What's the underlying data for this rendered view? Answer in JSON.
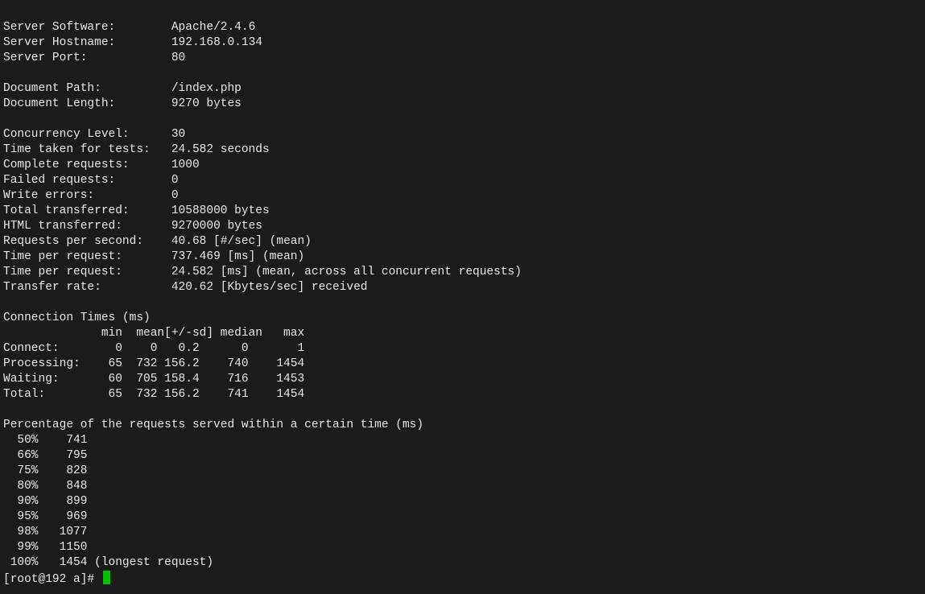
{
  "section1": {
    "server_software_label": "Server Software:",
    "server_software": "Apache/2.4.6",
    "server_hostname_label": "Server Hostname:",
    "server_hostname": "192.168.0.134",
    "server_port_label": "Server Port:",
    "server_port": "80"
  },
  "section2": {
    "document_path_label": "Document Path:",
    "document_path": "/index.php",
    "document_length_label": "Document Length:",
    "document_length": "9270 bytes"
  },
  "section3": {
    "concurrency_label": "Concurrency Level:",
    "concurrency": "30",
    "time_taken_label": "Time taken for tests:",
    "time_taken": "24.582 seconds",
    "complete_requests_label": "Complete requests:",
    "complete_requests": "1000",
    "failed_requests_label": "Failed requests:",
    "failed_requests": "0",
    "write_errors_label": "Write errors:",
    "write_errors": "0",
    "total_transferred_label": "Total transferred:",
    "total_transferred": "10588000 bytes",
    "html_transferred_label": "HTML transferred:",
    "html_transferred": "9270000 bytes",
    "requests_per_second_label": "Requests per second:",
    "requests_per_second": "40.68 [#/sec] (mean)",
    "time_per_request1_label": "Time per request:",
    "time_per_request1": "737.469 [ms] (mean)",
    "time_per_request2_label": "Time per request:",
    "time_per_request2": "24.582 [ms] (mean, across all concurrent requests)",
    "transfer_rate_label": "Transfer rate:",
    "transfer_rate": "420.62 [Kbytes/sec] received"
  },
  "conn_times": {
    "title": "Connection Times (ms)",
    "header": "              min  mean[+/-sd] median   max",
    "connect": "Connect:        0    0   0.2      0       1",
    "processing": "Processing:    65  732 156.2    740    1454",
    "waiting": "Waiting:       60  705 158.4    716    1453",
    "total": "Total:         65  732 156.2    741    1454"
  },
  "percentiles": {
    "title": "Percentage of the requests served within a certain time (ms)",
    "p50": "  50%    741",
    "p66": "  66%    795",
    "p75": "  75%    828",
    "p80": "  80%    848",
    "p90": "  90%    899",
    "p95": "  95%    969",
    "p98": "  98%   1077",
    "p99": "  99%   1150",
    "p100": " 100%   1454 (longest request)"
  },
  "prompt": {
    "text": "[root@192 a]# "
  }
}
